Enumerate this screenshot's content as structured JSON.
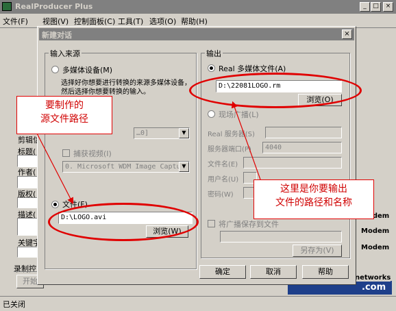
{
  "window": {
    "title": "RealProducer Plus"
  },
  "menu": [
    "文件(F)",
    "视图(V)",
    "控制面板(C)",
    "工具(T)",
    "选项(O)",
    "帮助(H)"
  ],
  "main": {
    "title_section": "剪辑信",
    "title_label": "标题(",
    "author_label": "作者(",
    "copyright_label": "版权(",
    "desc_label": "描述(",
    "keyword_label": "关键字",
    "record_label": "录制控",
    "start_btn": "开始",
    "modem_1": "Modem",
    "modem_2": "Modem",
    "modem_3": "Modem",
    "banner_text": "networks",
    "banner_com": ".com",
    "status": "已关闭"
  },
  "dialog": {
    "title": "新建对话",
    "input_group": "输入来源",
    "media_device_option": "多媒体设备(M)",
    "media_device_desc": "选择好你想要进行转换的来源多媒体设备，然后选择你想要转换的输入。",
    "audio_device_value": "…0]",
    "capture_video_check": "捕获视频(I)",
    "video_device_value": "0. Microsoft WDM Image Captur",
    "file_option": "文件(F)",
    "input_file_path": "D:\\LOGO.avi",
    "browse_btn": "浏览(W)",
    "output_group": "输出",
    "real_media_option": "Real 多媒体文件(A)",
    "output_file_path": "D:\\22081LOGO.rm",
    "output_browse_btn": "浏览(O)",
    "broadcast_option": "现场广播(L)",
    "server_label": "Real 服务器(S)",
    "port_label": "服务器端口(P)",
    "port_value": "4040",
    "filename_label": "文件名(E)",
    "username_label": "用户名(U)",
    "password_label": "密码(W)",
    "archive_check": "将广播保存到文件",
    "save_as_btn": "另存为(V)",
    "ok_btn": "确定",
    "cancel_btn": "取消",
    "help_btn": "帮助"
  },
  "annotations": {
    "left_line1": "要制作的",
    "left_line2": "源文件路径",
    "right_line1": "这里是你要输出",
    "right_line2": "文件的路径和名称"
  },
  "colors": {
    "annotation": "#e00000",
    "face": "#d4d0c8",
    "title_inactive": "#808080"
  }
}
